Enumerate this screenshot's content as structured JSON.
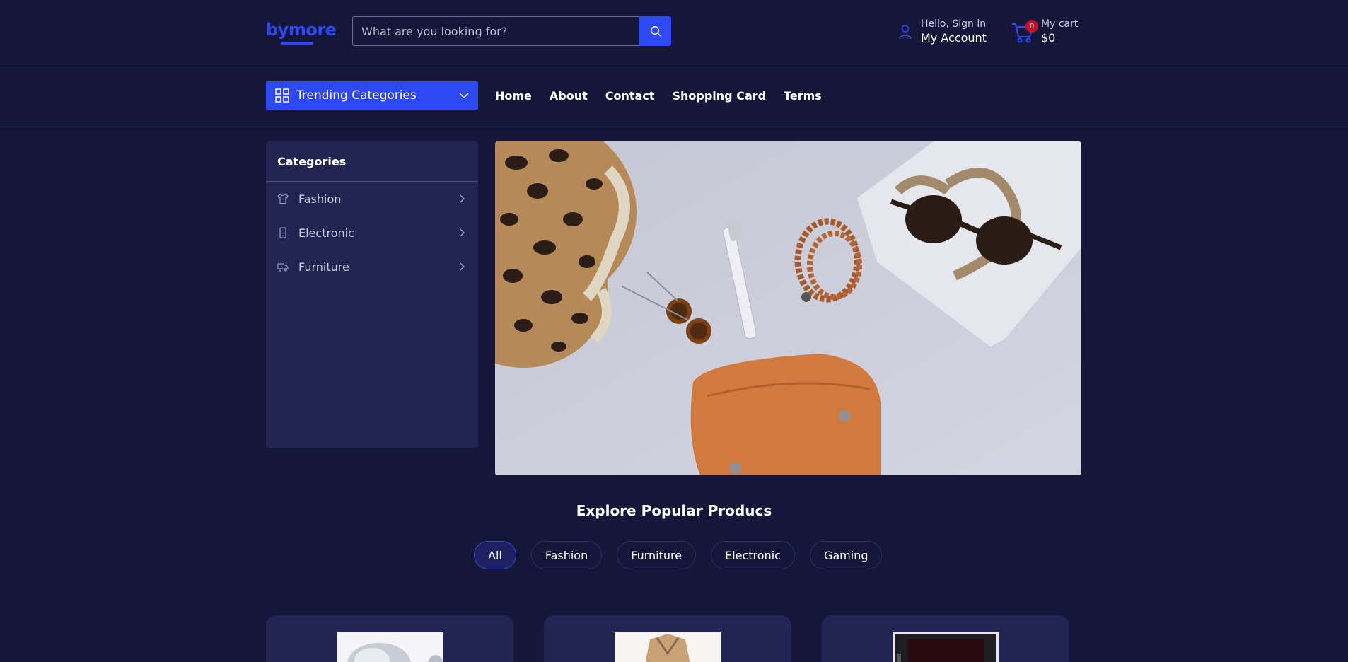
{
  "brand": {
    "logo_text": "bymore",
    "accent_color": "#2f48f5"
  },
  "search": {
    "placeholder": "What are you looking for?",
    "button_icon": "search-icon"
  },
  "account": {
    "greeting": "Hello, Sign in",
    "label": "My Account",
    "icon": "user-icon"
  },
  "cart": {
    "label": "My cart",
    "total": "$0",
    "count": "0",
    "icon": "cart-icon"
  },
  "nav": {
    "trending_label": "Trending Categories",
    "links": [
      "Home",
      "About",
      "Contact",
      "Shopping Card",
      "Terms"
    ]
  },
  "sidebar": {
    "title": "Categories",
    "items": [
      {
        "label": "Fashion",
        "icon": "shirt-icon"
      },
      {
        "label": "Electronic",
        "icon": "phone-icon"
      },
      {
        "label": "Furniture",
        "icon": "truck-icon"
      }
    ]
  },
  "popular": {
    "title": "Explore Popular Producs",
    "filters": [
      "All",
      "Fashion",
      "Furniture",
      "Electronic",
      "Gaming"
    ],
    "active_filter": "All"
  }
}
